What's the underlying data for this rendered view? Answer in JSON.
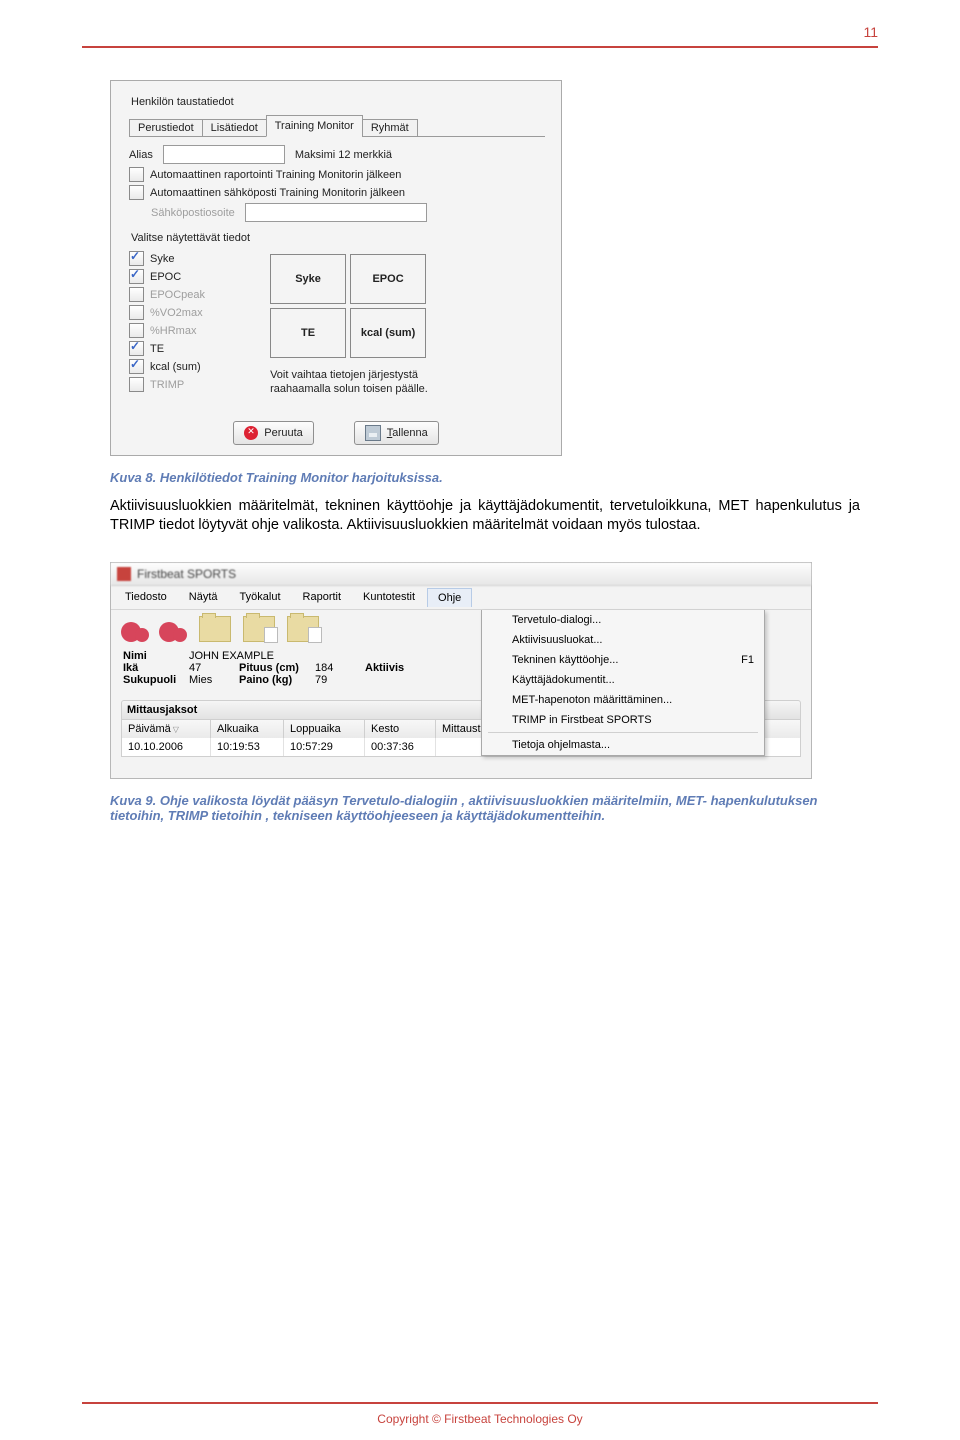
{
  "page_number": "11",
  "copyright": "Copyright © Firstbeat Technologies Oy",
  "dlg1": {
    "group_title": "Henkilön taustatiedot",
    "tabs": [
      "Perustiedot",
      "Lisätiedot",
      "Training Monitor",
      "Ryhmät"
    ],
    "alias_label": "Alias",
    "alias_hint": "Maksimi 12 merkkiä",
    "auto_report": "Automaattinen raportointi Training Monitorin jälkeen",
    "auto_email": "Automaattinen sähköposti Training Monitorin jälkeen",
    "email_label": "Sähköpostiosoite",
    "display_title": "Valitse näytettävät tiedot",
    "checks": [
      {
        "label": "Syke",
        "checked": true
      },
      {
        "label": "EPOC",
        "checked": true
      },
      {
        "label": "EPOCpeak",
        "checked": false
      },
      {
        "label": "%VO2max",
        "checked": false
      },
      {
        "label": "%HRmax",
        "checked": false
      },
      {
        "label": "TE",
        "checked": true
      },
      {
        "label": "kcal (sum)",
        "checked": true
      },
      {
        "label": "TRIMP",
        "checked": false
      }
    ],
    "cells": [
      "Syke",
      "EPOC",
      "TE",
      "kcal (sum)"
    ],
    "reorder_hint1": "Voit vaihtaa tietojen järjestystä",
    "reorder_hint2": "raahaamalla solun toisen päälle.",
    "cancel": "Peruuta",
    "save": "Tallenna",
    "save_ul": "T"
  },
  "caption1": "Kuva 8. Henkilötiedot Training Monitor harjoituksissa.",
  "bodytext": "Aktiivisuusluokkien määritelmät, tekninen käyttöohje ja käyttäjädokumentit, tervetuloikkuna, MET hapenkulutus ja TRIMP tiedot löytyvät ohje valikosta. Aktiivisuusluokkien määritelmät voidaan myös tulostaa.",
  "dlg2": {
    "title": "Firstbeat SPORTS",
    "menus": [
      "Tiedosto",
      "Näytä",
      "Työkalut",
      "Raportit",
      "Kuntotestit",
      "Ohje"
    ],
    "submenu": [
      {
        "label": "Tervetulo-dialogi...",
        "sc": ""
      },
      {
        "label": "Aktiivisuusluokat...",
        "sc": ""
      },
      {
        "label": "Tekninen käyttöohje...",
        "sc": "F1"
      },
      {
        "label": "Käyttäjädokumentit...",
        "sc": ""
      },
      {
        "label": "MET-hapenoton määrittäminen...",
        "sc": ""
      },
      {
        "label": "TRIMP in Firstbeat SPORTS",
        "sc": ""
      }
    ],
    "submenu_sep_after": 5,
    "submenu_last": {
      "label": "Tietoja ohjelmasta...",
      "sc": ""
    },
    "info": {
      "name_lbl": "Nimi",
      "name": "JOHN EXAMPLE",
      "age_lbl": "Ikä",
      "age": "47",
      "height_lbl": "Pituus (cm)",
      "height": "184",
      "act_lbl": "Aktiivis",
      "sex_lbl": "Sukupuoli",
      "sex": "Mies",
      "weight_lbl": "Paino (kg)",
      "weight": "79"
    },
    "section": "Mittausjaksot",
    "headers": [
      "Päivämä",
      "Alkuaika",
      "Loppuaika",
      "Kesto",
      "Mittaust"
    ],
    "row": [
      "10.10.2006",
      "10:19:53",
      "10:57:29",
      "00:37:36",
      ""
    ]
  },
  "caption2": "Kuva 9. Ohje valikosta löydät pääsyn Tervetulo-dialogiin , aktiivisuusluokkien määritelmiin, MET- hapenkulutuksen tietoihin, TRIMP tietoihin , tekniseen käyttöohjeeseen ja käyttäjädokumentteihin."
}
